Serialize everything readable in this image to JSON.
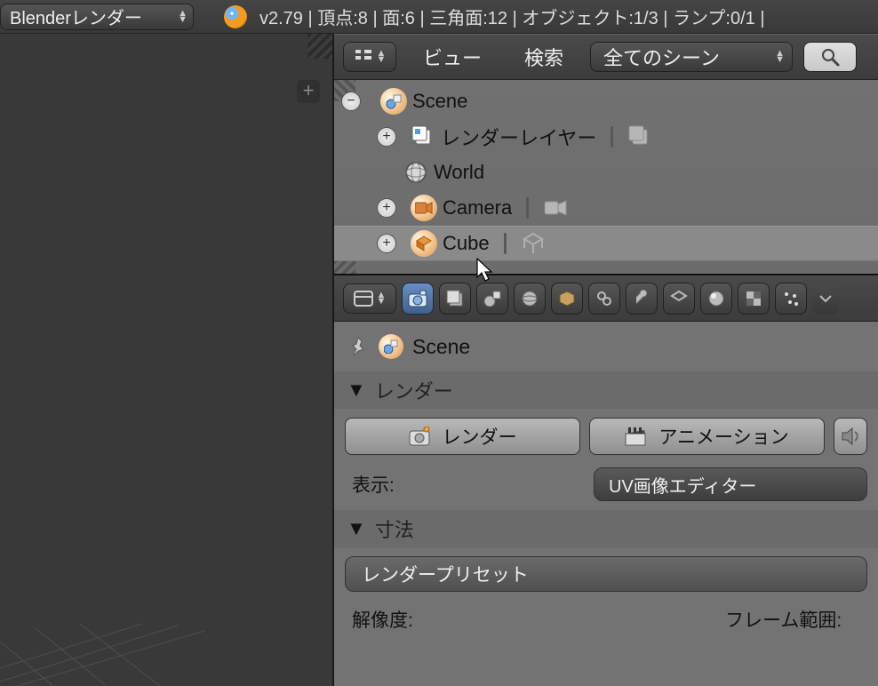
{
  "topbar": {
    "render_engine": "Blenderレンダー",
    "version": "v2.79",
    "stats": "頂点:8 | 面:6 | 三角面:12 | オブジェクト:1/3 | ランプ:0/1 |"
  },
  "outliner": {
    "menu_view": "ビュー",
    "menu_search": "検索",
    "filter": "全てのシーン",
    "tree": {
      "scene": "Scene",
      "render_layers": "レンダーレイヤー",
      "world": "World",
      "camera": "Camera",
      "cube": "Cube"
    }
  },
  "props": {
    "context_scene": "Scene",
    "panel_render": "レンダー",
    "btn_render": "レンダー",
    "btn_animation": "アニメーション",
    "label_display": "表示:",
    "display_mode": "UV画像エディター",
    "panel_dimensions": "寸法",
    "btn_presets": "レンダープリセット",
    "label_resolution": "解像度:",
    "label_frame_range": "フレーム範囲:"
  }
}
